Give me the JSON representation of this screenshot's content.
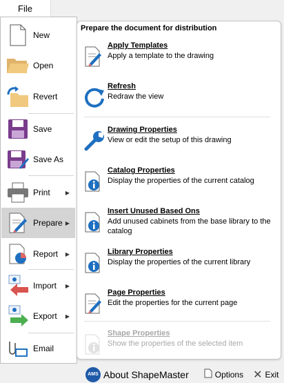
{
  "header": {
    "file_tab": "File"
  },
  "menu": {
    "items": [
      {
        "key": "new",
        "label": "New",
        "icon": "new-document-icon",
        "has_arrow": false,
        "active": false
      },
      {
        "key": "open",
        "label": "Open",
        "icon": "folder-open-icon",
        "has_arrow": false,
        "active": false
      },
      {
        "key": "revert",
        "label": "Revert",
        "icon": "revert-folder-icon",
        "has_arrow": false,
        "active": false
      },
      {
        "key": "save",
        "label": "Save",
        "icon": "floppy-disk-icon",
        "has_arrow": false,
        "active": false
      },
      {
        "key": "save-as",
        "label": "Save As",
        "icon": "floppy-pencil-icon",
        "has_arrow": false,
        "active": false
      },
      {
        "key": "print",
        "label": "Print",
        "icon": "printer-icon",
        "has_arrow": true,
        "active": false
      },
      {
        "key": "prepare",
        "label": "Prepare",
        "icon": "prepare-pencil-icon",
        "has_arrow": true,
        "active": true
      },
      {
        "key": "report",
        "label": "Report",
        "icon": "report-chart-icon",
        "has_arrow": true,
        "active": false
      },
      {
        "key": "import",
        "label": "Import",
        "icon": "import-arrow-icon",
        "has_arrow": true,
        "active": false
      },
      {
        "key": "export",
        "label": "Export",
        "icon": "export-arrow-icon",
        "has_arrow": true,
        "active": false
      },
      {
        "key": "email",
        "label": "Email",
        "icon": "email-attach-icon",
        "has_arrow": false,
        "active": false
      }
    ]
  },
  "submenu": {
    "heading": "Prepare the document for distribution",
    "items": [
      {
        "key": "apply-templates",
        "title": "Apply Templates",
        "desc": "Apply a template to the drawing",
        "icon": "template-pencil-icon",
        "disabled": false
      },
      {
        "key": "refresh",
        "title": "Refresh",
        "desc": "Redraw the view",
        "icon": "refresh-icon",
        "disabled": false
      },
      {
        "key": "drawing-properties",
        "title": "Drawing Properties",
        "desc": "View or edit the setup of this drawing",
        "icon": "wrench-icon",
        "disabled": false
      },
      {
        "key": "catalog-properties",
        "title": "Catalog Properties",
        "desc": "Display the properties of the current catalog",
        "icon": "info-document-icon",
        "disabled": false
      },
      {
        "key": "insert-unused",
        "title": "Insert Unused Based Ons",
        "desc": "Add unused cabinets from the base library to the catalog",
        "icon": "info-document-icon",
        "disabled": false
      },
      {
        "key": "library-properties",
        "title": "Library Properties",
        "desc": "Display the properties of the current library",
        "icon": "info-document-icon",
        "disabled": false
      },
      {
        "key": "page-properties",
        "title": "Page Properties",
        "desc": "Edit the properties for the current page",
        "icon": "page-pencil-icon",
        "disabled": false
      },
      {
        "key": "shape-properties",
        "title": "Shape Properties",
        "desc": "Show the properties of the selected item",
        "icon": "info-document-icon",
        "disabled": true
      }
    ]
  },
  "footer": {
    "logo_text": "AMS",
    "about_label": "About ShapeMaster",
    "options_label": "Options",
    "exit_label": "Exit"
  },
  "colors": {
    "accent_blue": "#1e6fc0",
    "active_bg": "#d4d4d4",
    "disabled_text": "#a8a8a8"
  }
}
